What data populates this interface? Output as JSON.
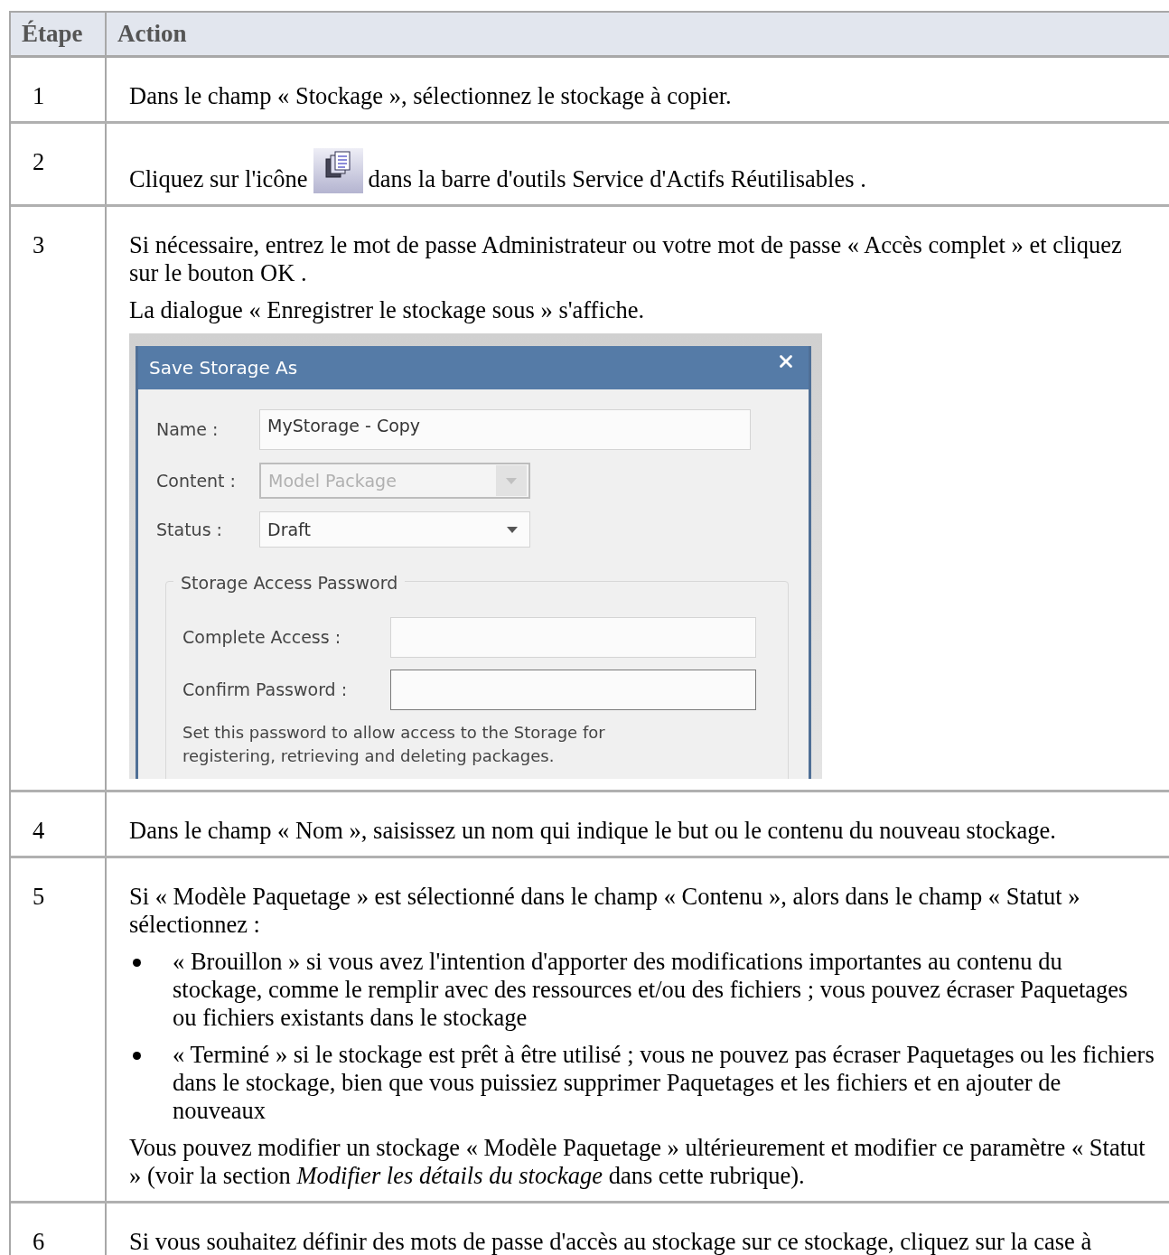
{
  "table": {
    "columns": [
      "Étape",
      "Action"
    ],
    "rows": [
      {
        "step": "1",
        "blocks": [
          {
            "kind": "paragraph",
            "text": "Dans le champ « Stockage », sélectionnez le stockage à copier."
          }
        ]
      },
      {
        "step": "2",
        "blocks": [
          {
            "kind": "icon_sentence",
            "before": "Cliquez sur l'icône",
            "after": "dans la barre d'outils Service d'Actifs Réutilisables ."
          }
        ]
      },
      {
        "step": "3",
        "blocks": [
          {
            "kind": "paragraph",
            "text": "Si nécessaire, entrez le mot de passe Administrateur ou votre mot de passe « Accès complet » et cliquez sur le bouton OK ."
          },
          {
            "kind": "paragraph",
            "text": "La dialogue « Enregistrer le stockage sous » s'affiche."
          },
          {
            "kind": "dialog",
            "title": "Save Storage As",
            "fields": [
              {
                "label": "Name :",
                "value": "MyStorage - Copy",
                "kind": "text",
                "disabled": false
              },
              {
                "label": "Content :",
                "value": "Model Package",
                "kind": "select",
                "disabled": true
              },
              {
                "label": "Status :",
                "value": "Draft",
                "kind": "select",
                "disabled": false
              }
            ],
            "group": {
              "title": "Storage Access Password",
              "fields": [
                {
                  "label": "Complete Access :",
                  "focused": false
                },
                {
                  "label": "Confirm Password :",
                  "focused": true
                }
              ],
              "note": "Set this password to allow access to the Storage for registering, retrieving and deleting packages."
            }
          }
        ]
      },
      {
        "step": "4",
        "blocks": [
          {
            "kind": "paragraph",
            "text": "Dans le champ « Nom », saisissez un nom qui indique le but ou le contenu du nouveau stockage."
          }
        ]
      },
      {
        "step": "5",
        "blocks": [
          {
            "kind": "paragraph",
            "text": "Si « Modèle Paquetage » est sélectionné dans le champ « Contenu », alors dans le champ « Statut » sélectionnez :"
          },
          {
            "kind": "bullets",
            "items": [
              "« Brouillon » si vous avez l'intention d'apporter des modifications importantes au contenu du stockage, comme le remplir avec des ressources et/ou des fichiers ; vous pouvez écraser Paquetages ou fichiers existants dans le stockage",
              "« Terminé » si le stockage est prêt à être utilisé ; vous ne pouvez pas écraser Paquetages ou les fichiers dans le stockage, bien que vous puissiez supprimer Paquetages et les fichiers et en ajouter de nouveaux"
            ]
          },
          {
            "kind": "paragraph",
            "text": "Vous pouvez modifier un stockage « Modèle Paquetage » ultérieurement et modifier ce paramètre « Statut » (voir la section *Modifier les détails du stockage* dans cette rubrique)."
          }
        ]
      },
      {
        "step": "6",
        "blocks": [
          {
            "kind": "paragraph",
            "text": "Si vous souhaitez définir des mots de passe d'accès au stockage sur ce stockage, cliquez sur la case à"
          }
        ]
      }
    ]
  }
}
